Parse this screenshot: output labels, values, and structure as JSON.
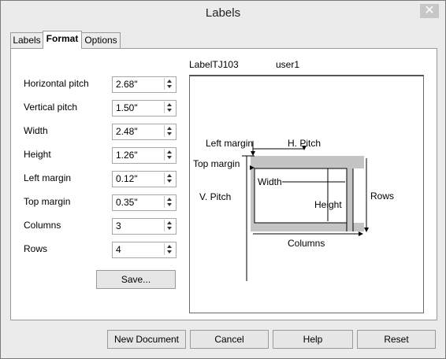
{
  "window": {
    "title": "Labels",
    "close_glyph": "✕"
  },
  "tabs": [
    {
      "label": "Labels",
      "active": false
    },
    {
      "label": "Format",
      "active": true
    },
    {
      "label": "Options",
      "active": false
    }
  ],
  "header": {
    "label_type": "LabelTJ103",
    "user": "user1"
  },
  "fields": [
    {
      "label": "Horizontal pitch",
      "value": "2.68\""
    },
    {
      "label": "Vertical pitch",
      "value": "1.50\""
    },
    {
      "label": "Width",
      "value": "2.48\""
    },
    {
      "label": "Height",
      "value": "1.26\""
    },
    {
      "label": "Left margin",
      "value": "0.12\""
    },
    {
      "label": "Top margin",
      "value": "0.35\""
    },
    {
      "label": "Columns",
      "value": "3"
    },
    {
      "label": "Rows",
      "value": "4"
    }
  ],
  "save_button": "Save...",
  "preview": {
    "left_margin": "Left margin",
    "h_pitch": "H. Pitch",
    "top_margin": "Top margin",
    "width": "Width",
    "v_pitch": "V. Pitch",
    "height": "Height",
    "rows": "Rows",
    "columns": "Columns"
  },
  "footer": {
    "new_document": "New Document",
    "cancel": "Cancel",
    "help": "Help",
    "reset": "Reset"
  },
  "colors": {
    "label_gray": "#c4c4c4",
    "panel_bg": "#ffffff",
    "window_bg": "#ebebeb"
  },
  "icons": {
    "close": "close-icon",
    "spin_up": "spin-up-icon",
    "spin_down": "spin-down-icon"
  }
}
